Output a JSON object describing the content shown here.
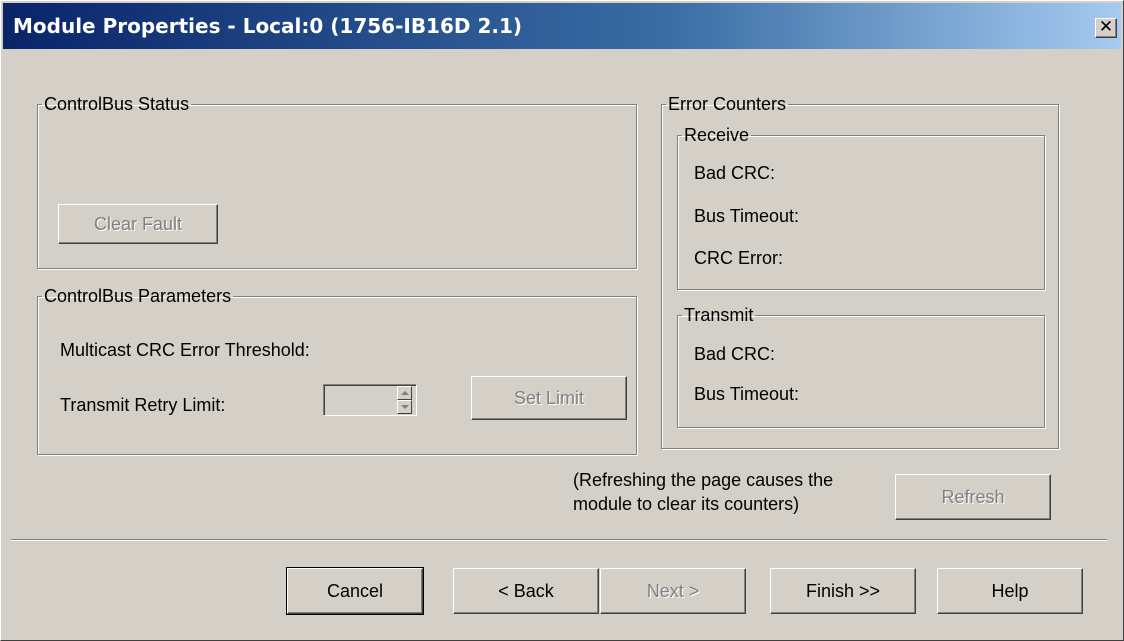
{
  "window": {
    "title": "Module Properties - Local:0 (1756-IB16D 2.1)",
    "close_glyph": "✕"
  },
  "status_group": {
    "title": "ControlBus Status",
    "clear_fault_label": "Clear Fault"
  },
  "params_group": {
    "title": "ControlBus Parameters",
    "multicast_label": "Multicast CRC Error Threshold:",
    "retry_label": "Transmit Retry Limit:",
    "retry_value": "",
    "set_limit_label": "Set Limit"
  },
  "error_counters": {
    "title": "Error Counters",
    "receive": {
      "title": "Receive",
      "bad_crc": "Bad CRC:",
      "bus_timeout": "Bus Timeout:",
      "crc_error": "CRC Error:"
    },
    "transmit": {
      "title": "Transmit",
      "bad_crc": "Bad CRC:",
      "bus_timeout": "Bus Timeout:"
    }
  },
  "refresh": {
    "note_line1": "(Refreshing the page causes the",
    "note_line2": "module to clear its counters)",
    "button_label": "Refresh"
  },
  "footer": {
    "cancel": "Cancel",
    "back": "< Back",
    "next": "Next >",
    "finish": "Finish >>",
    "help": "Help"
  },
  "colors": {
    "dialog_bg": "#d4d0c8",
    "title_gradient_start": "#0a246a",
    "title_gradient_end": "#a6caf0",
    "disabled_text": "#808080"
  }
}
